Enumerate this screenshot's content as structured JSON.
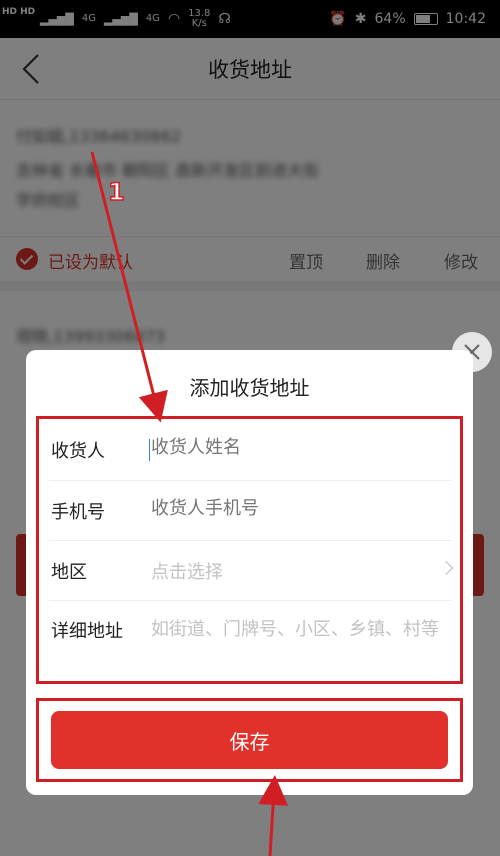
{
  "status_bar": {
    "net_badge": "HD HD",
    "signal1": "4G",
    "signal2": "4G",
    "speed": "13.8",
    "speed_unit": "K/s",
    "battery": "64%",
    "time": "10:42"
  },
  "header": {
    "title": "收货地址"
  },
  "address_list": {
    "item1": {
      "line1": "付如姐,13364630862",
      "line2": "吉林省 长春市 朝阳区 高新开发区前进大街",
      "line3": "学府校区"
    },
    "item1_default_label": "已设为默认",
    "actions": [
      "置顶",
      "删除",
      "修改"
    ],
    "item2": {
      "line1": "观晓,13993306873"
    }
  },
  "dialog": {
    "title": "添加收货地址",
    "fields": [
      {
        "label": "收货人",
        "placeholder": "收货人姓名"
      },
      {
        "label": "手机号",
        "placeholder": "收货人手机号"
      },
      {
        "label": "地区",
        "placeholder": "点击选择"
      },
      {
        "label": "详细地址",
        "placeholder": "如街道、门牌号、小区、乡镇、村等"
      }
    ],
    "save_label": "保存"
  },
  "annotation": {
    "step_number": "1",
    "color": "#d01f24"
  },
  "colors": {
    "accent": "#d8332b"
  }
}
